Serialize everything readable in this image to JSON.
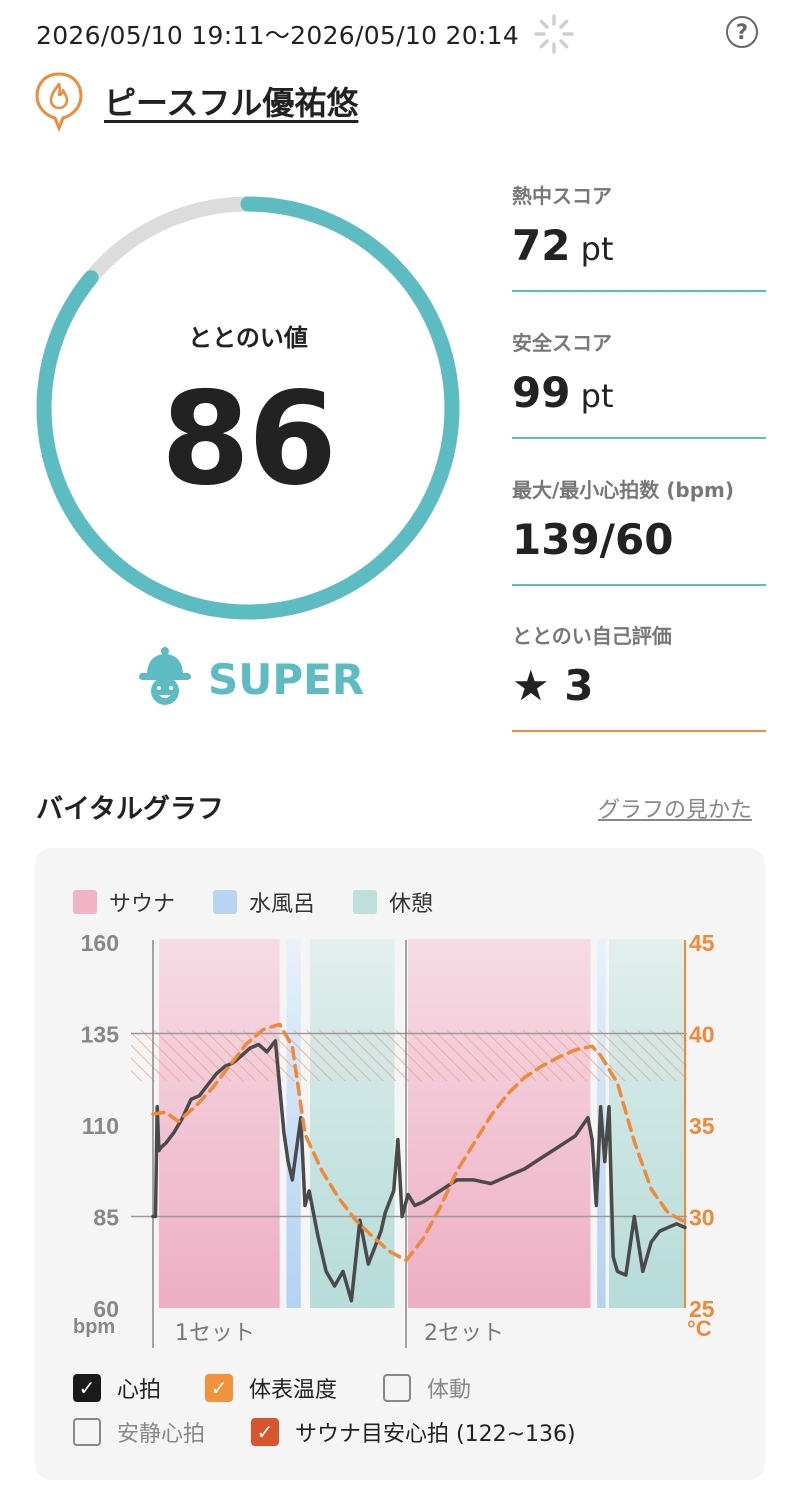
{
  "header": {
    "date_range": "2026/05/10 19:11～2026/05/10 20:14",
    "help_label": "?"
  },
  "facility": {
    "name": "ピースフル優祐悠"
  },
  "score": {
    "label": "ととのい値",
    "value": 86,
    "max": 100,
    "rank": "SUPER",
    "ring_color": "#5cbcc2",
    "track_color": "#dcdcdc"
  },
  "stats": [
    {
      "label": "熱中スコア",
      "value": "72",
      "unit": " pt"
    },
    {
      "label": "安全スコア",
      "value": "99",
      "unit": " pt"
    },
    {
      "label": "最大/最小心拍数 (bpm)",
      "value": "139/60",
      "unit": ""
    },
    {
      "label": "ととのい自己評価",
      "value": "★ 3",
      "unit": ""
    }
  ],
  "graph": {
    "title": "バイタルグラフ",
    "guide_link": "グラフの見かた",
    "legend": [
      {
        "label": "サウナ",
        "color": "#f2b3c6"
      },
      {
        "label": "水風呂",
        "color": "#b7d5f3"
      },
      {
        "label": "休憩",
        "color": "#bfdfdd"
      }
    ],
    "checkboxes": [
      {
        "label": "心拍",
        "checked": true
      },
      {
        "label": "体表温度",
        "checked": true
      },
      {
        "label": "体動",
        "checked": false
      },
      {
        "label": "安静心拍",
        "checked": false
      },
      {
        "label": "サウナ目安心拍 (122~136)",
        "checked": true
      }
    ]
  },
  "chart_data": {
    "type": "line",
    "x_labels": [
      "1セット",
      "2セット"
    ],
    "ylabel": "bpm",
    "ylabel_right": "°C",
    "y_ticks": [
      160,
      135,
      110,
      85,
      60
    ],
    "y2_ticks": [
      45,
      40,
      35,
      30,
      25
    ],
    "ylim": [
      60,
      160
    ],
    "y2lim": [
      25,
      45
    ],
    "reference_band": [
      122,
      136
    ],
    "reference_lines": [
      135,
      85
    ],
    "x_range": [
      0,
      63
    ],
    "phases": [
      {
        "type": "sauna",
        "start": 0.7,
        "end": 15.0
      },
      {
        "type": "cold_bath",
        "start": 15.8,
        "end": 17.5
      },
      {
        "type": "rest",
        "start": 18.6,
        "end": 28.6
      },
      {
        "type": "sauna",
        "start": 30.2,
        "end": 51.8
      },
      {
        "type": "cold_bath",
        "start": 52.6,
        "end": 53.6
      },
      {
        "type": "rest",
        "start": 54.0,
        "end": 63.0
      }
    ],
    "set_markers": [
      0.7,
      30.2
    ],
    "series": [
      {
        "name": "心拍",
        "color": "#4a4a4a",
        "x": [
          0,
          0.3,
          0.5,
          0.7,
          1.0,
          1.5,
          2.5,
          3.5,
          4.5,
          5.5,
          6.5,
          7.5,
          8.5,
          9.5,
          10.5,
          11.5,
          12.5,
          13.5,
          14.5,
          15.5,
          16.0,
          16.5,
          17.5,
          18.0,
          18.5,
          19.5,
          20.5,
          21.5,
          22.5,
          23.5,
          24.5,
          25.5,
          26.5,
          27.0,
          27.5,
          28.5,
          29.0,
          29.5,
          30.2,
          31.0,
          32.0,
          34.0,
          36.0,
          38.0,
          40.0,
          42.0,
          44.0,
          46.0,
          48.0,
          50.0,
          51.5,
          52.0,
          52.5,
          53.0,
          53.5,
          54.0,
          54.5,
          55.0,
          56.0,
          57.0,
          58.0,
          59.0,
          60.0,
          61.0,
          62.0,
          63.0
        ],
        "values": [
          85,
          85,
          115,
          103,
          104,
          105,
          108,
          112,
          117,
          118,
          121,
          124,
          126,
          127,
          129,
          131,
          132,
          130,
          133,
          108,
          100,
          95,
          112,
          88,
          92,
          80,
          70,
          66,
          70,
          62,
          84,
          72,
          78,
          81,
          86,
          92,
          106,
          85,
          91,
          88,
          89,
          92,
          95,
          95,
          94,
          96,
          98,
          101,
          104,
          107,
          112,
          106,
          88,
          115,
          100,
          115,
          74,
          70,
          69,
          85,
          70,
          78,
          81,
          82,
          83,
          82
        ]
      },
      {
        "name": "体表温度",
        "color": "#ee8a3a",
        "x": [
          0,
          1.5,
          3,
          5,
          7,
          9,
          11,
          13,
          15,
          16.5,
          18,
          20,
          22,
          24,
          26,
          28,
          30,
          32,
          34,
          36,
          38,
          40,
          42,
          44,
          46,
          48,
          50,
          52,
          53,
          55,
          57,
          59,
          61,
          63
        ],
        "values": [
          35.6,
          35.7,
          35.2,
          36.0,
          37.0,
          38.2,
          39.4,
          40.2,
          40.5,
          39.3,
          34.5,
          32.5,
          31.0,
          29.8,
          28.9,
          28.1,
          27.6,
          28.8,
          30.5,
          32.5,
          34.0,
          35.5,
          36.7,
          37.6,
          38.2,
          38.7,
          39.1,
          39.3,
          38.8,
          37.3,
          34.1,
          31.5,
          30.2,
          29.7
        ]
      }
    ]
  }
}
